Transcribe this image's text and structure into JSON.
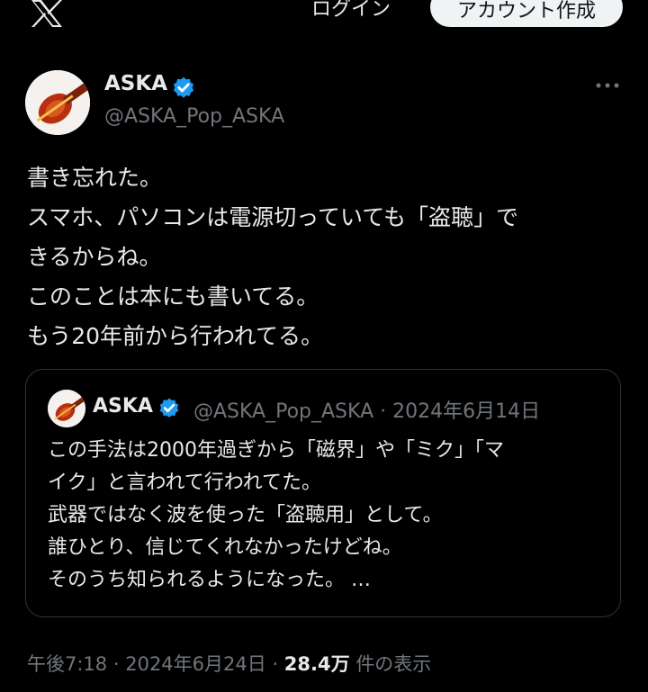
{
  "topbar": {
    "logo_icon": "x-logo-icon",
    "login_label": "ログイン",
    "signup_label": "アカウント作成"
  },
  "tweet": {
    "author_name": "ASKA",
    "author_handle": "@ASKA_Pop_ASKA",
    "verified_icon": "verified-badge-icon",
    "more_icon": "more-options-icon",
    "text_lines": [
      "書き忘れた。",
      "スマホ、パソコンは電源切っていても「盗聴」で",
      "きるからね。",
      "このことは本にも書いてる。",
      "もう20年前から行われてる。"
    ],
    "time": "午後7:18",
    "date": "2024年6月24日",
    "views_count": "28.4万",
    "views_label": "件の表示"
  },
  "quote": {
    "author_name": "ASKA",
    "author_handle": "@ASKA_Pop_ASKA",
    "date": "2024年6月14日",
    "text_lines": [
      "この手法は2000年過ぎから「磁界」や「ミク」「マ",
      "イク」と言われて行われてた。",
      "武器ではなく波を使った「盗聴用」として。",
      "誰ひとり、信じてくれなかったけどね。",
      "そのうち知られるようになった。 …"
    ]
  },
  "colors": {
    "background": "#000000",
    "text": "#e7e9ea",
    "muted": "#71767b",
    "verified": "#1d9bf0",
    "border": "#2f3336"
  }
}
